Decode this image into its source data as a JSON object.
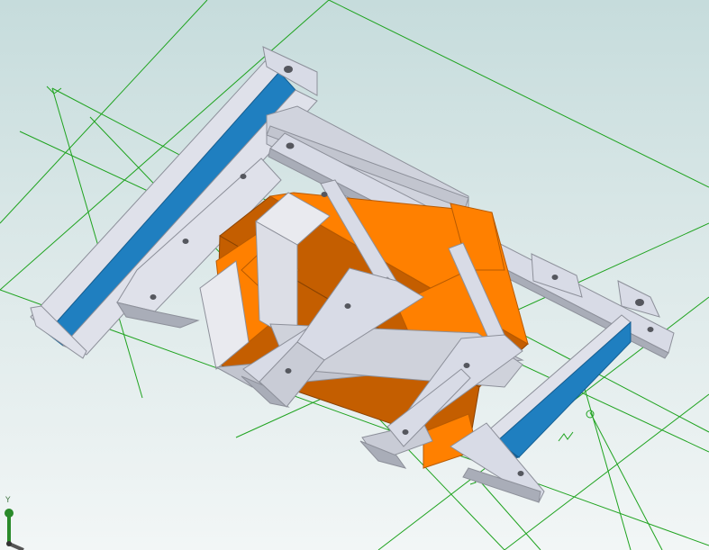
{
  "viewport": {
    "background_top": "#c6dcdc",
    "background_bottom": "#f2f6f6"
  },
  "colors": {
    "sketch_line": "#1fa31f",
    "sheet_metal": "#dfe1ea",
    "sheet_metal_side": "#a9adb8",
    "sheet_metal_edge": "#8d909a",
    "bracket_top": "#d8dbe6",
    "channel_blue": "#1f7fc0",
    "channel_blue_dark": "#155f93",
    "core_orange": "#ff8000",
    "core_orange_dark": "#c45e00",
    "hole": "#55575e"
  },
  "triad": {
    "y_label": "Y",
    "icon": "coordinate-triad-icon"
  }
}
